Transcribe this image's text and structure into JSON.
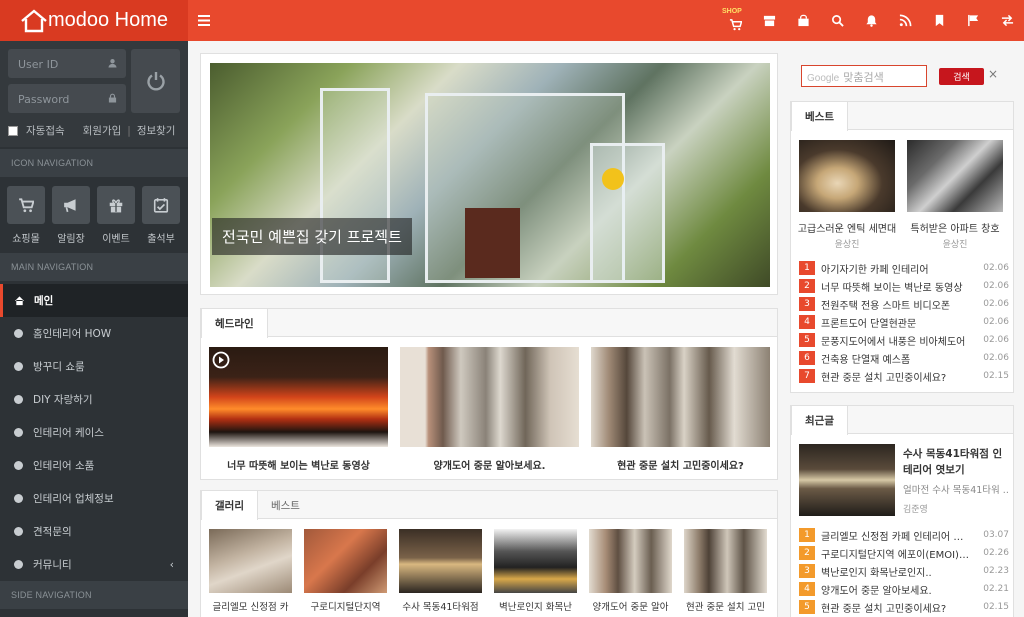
{
  "brand": {
    "logo_text": "modoo Home"
  },
  "topbar": {
    "shop_badge": "SHOP",
    "icons": [
      "cart-icon",
      "store-icon",
      "bag-icon",
      "search-icon",
      "bell-icon",
      "rss-icon",
      "bookmark-icon",
      "flag-icon",
      "swap-icon"
    ]
  },
  "login": {
    "userid_placeholder": "User ID",
    "password_placeholder": "Password",
    "auto_login": "자동접속",
    "signup": "회원가입",
    "find_info": "정보찾기"
  },
  "sidebar": {
    "icon_nav_title": "ICON NAVIGATION",
    "icon_items": [
      "쇼핑몰",
      "알림장",
      "이벤트",
      "출석부"
    ],
    "main_nav_title": "MAIN NAVIGATION",
    "menu": [
      "메인",
      "홈인테리어 HOW",
      "방꾸디 쇼룸",
      "DIY 자랑하기",
      "인테리어 케이스",
      "인테리어 소품",
      "인테리어 업체정보",
      "견적문의",
      "커뮤니티"
    ],
    "side_nav_title": "SIDE NAVIGATION"
  },
  "hero": {
    "caption": "전국민 예쁜집 갖기 프로젝트"
  },
  "headline": {
    "tab": "헤드라인",
    "items": [
      "너무 따뜻해 보이는 벽난로 동영상",
      "양개도어 중문 알아보세요.",
      "현관 중문 설치 고민중이세요?"
    ]
  },
  "gallery": {
    "tabs": [
      "갤러리",
      "베스트"
    ],
    "items": [
      "글리엘모 신정점 카",
      "구로디지털단지역",
      "수사 목동41타워점",
      "벽난로인지 화목난",
      "양개도어 중문 알아",
      "현관 중문 설치 고민"
    ]
  },
  "search": {
    "brand": "Google",
    "placeholder": "맞춤검색",
    "button": "검색",
    "close": "×"
  },
  "best": {
    "tab": "베스트",
    "featured": [
      {
        "title": "고급스러운 엔틱 세면대",
        "author": "윤상진"
      },
      {
        "title": "특허받은 아파트 창호",
        "author": "윤상진"
      }
    ],
    "ranks": [
      {
        "num": "1",
        "title": "아기자기한 카페 인테리어",
        "date": "02.06"
      },
      {
        "num": "2",
        "title": "너무 따뜻해 보이는 벽난로 동영상",
        "date": "02.06"
      },
      {
        "num": "3",
        "title": "전원주택 전용 스마트 비디오폰",
        "date": "02.06"
      },
      {
        "num": "4",
        "title": "프론트도어 단열현관문",
        "date": "02.06"
      },
      {
        "num": "5",
        "title": "문풍지도어에서 내풍은 비아체도어",
        "date": "02.06"
      },
      {
        "num": "6",
        "title": "건축용 단열재 예스폼",
        "date": "02.06"
      },
      {
        "num": "7",
        "title": "현관 중문 설치 고민중이세요?",
        "date": "02.15"
      }
    ]
  },
  "recent": {
    "tab": "최근글",
    "featured": {
      "title": "수사 목동41타워점 인테리어 엿보기",
      "sub": "얼마전 수사 목동41타워 ...",
      "author": "김준영"
    },
    "items": [
      {
        "num": "1",
        "title": "글리엘모 신정점 카페 인테리어 …",
        "date": "03.07"
      },
      {
        "num": "2",
        "title": "구로디지털단지역 에포이(EMOI)…",
        "date": "02.26"
      },
      {
        "num": "3",
        "title": "벽난로인지 화목난로인지..",
        "date": "02.23"
      },
      {
        "num": "4",
        "title": "양개도어 중문 알아보세요.",
        "date": "02.21"
      },
      {
        "num": "5",
        "title": "현관 중문 설치 고민중이세요?",
        "date": "02.15"
      }
    ]
  }
}
